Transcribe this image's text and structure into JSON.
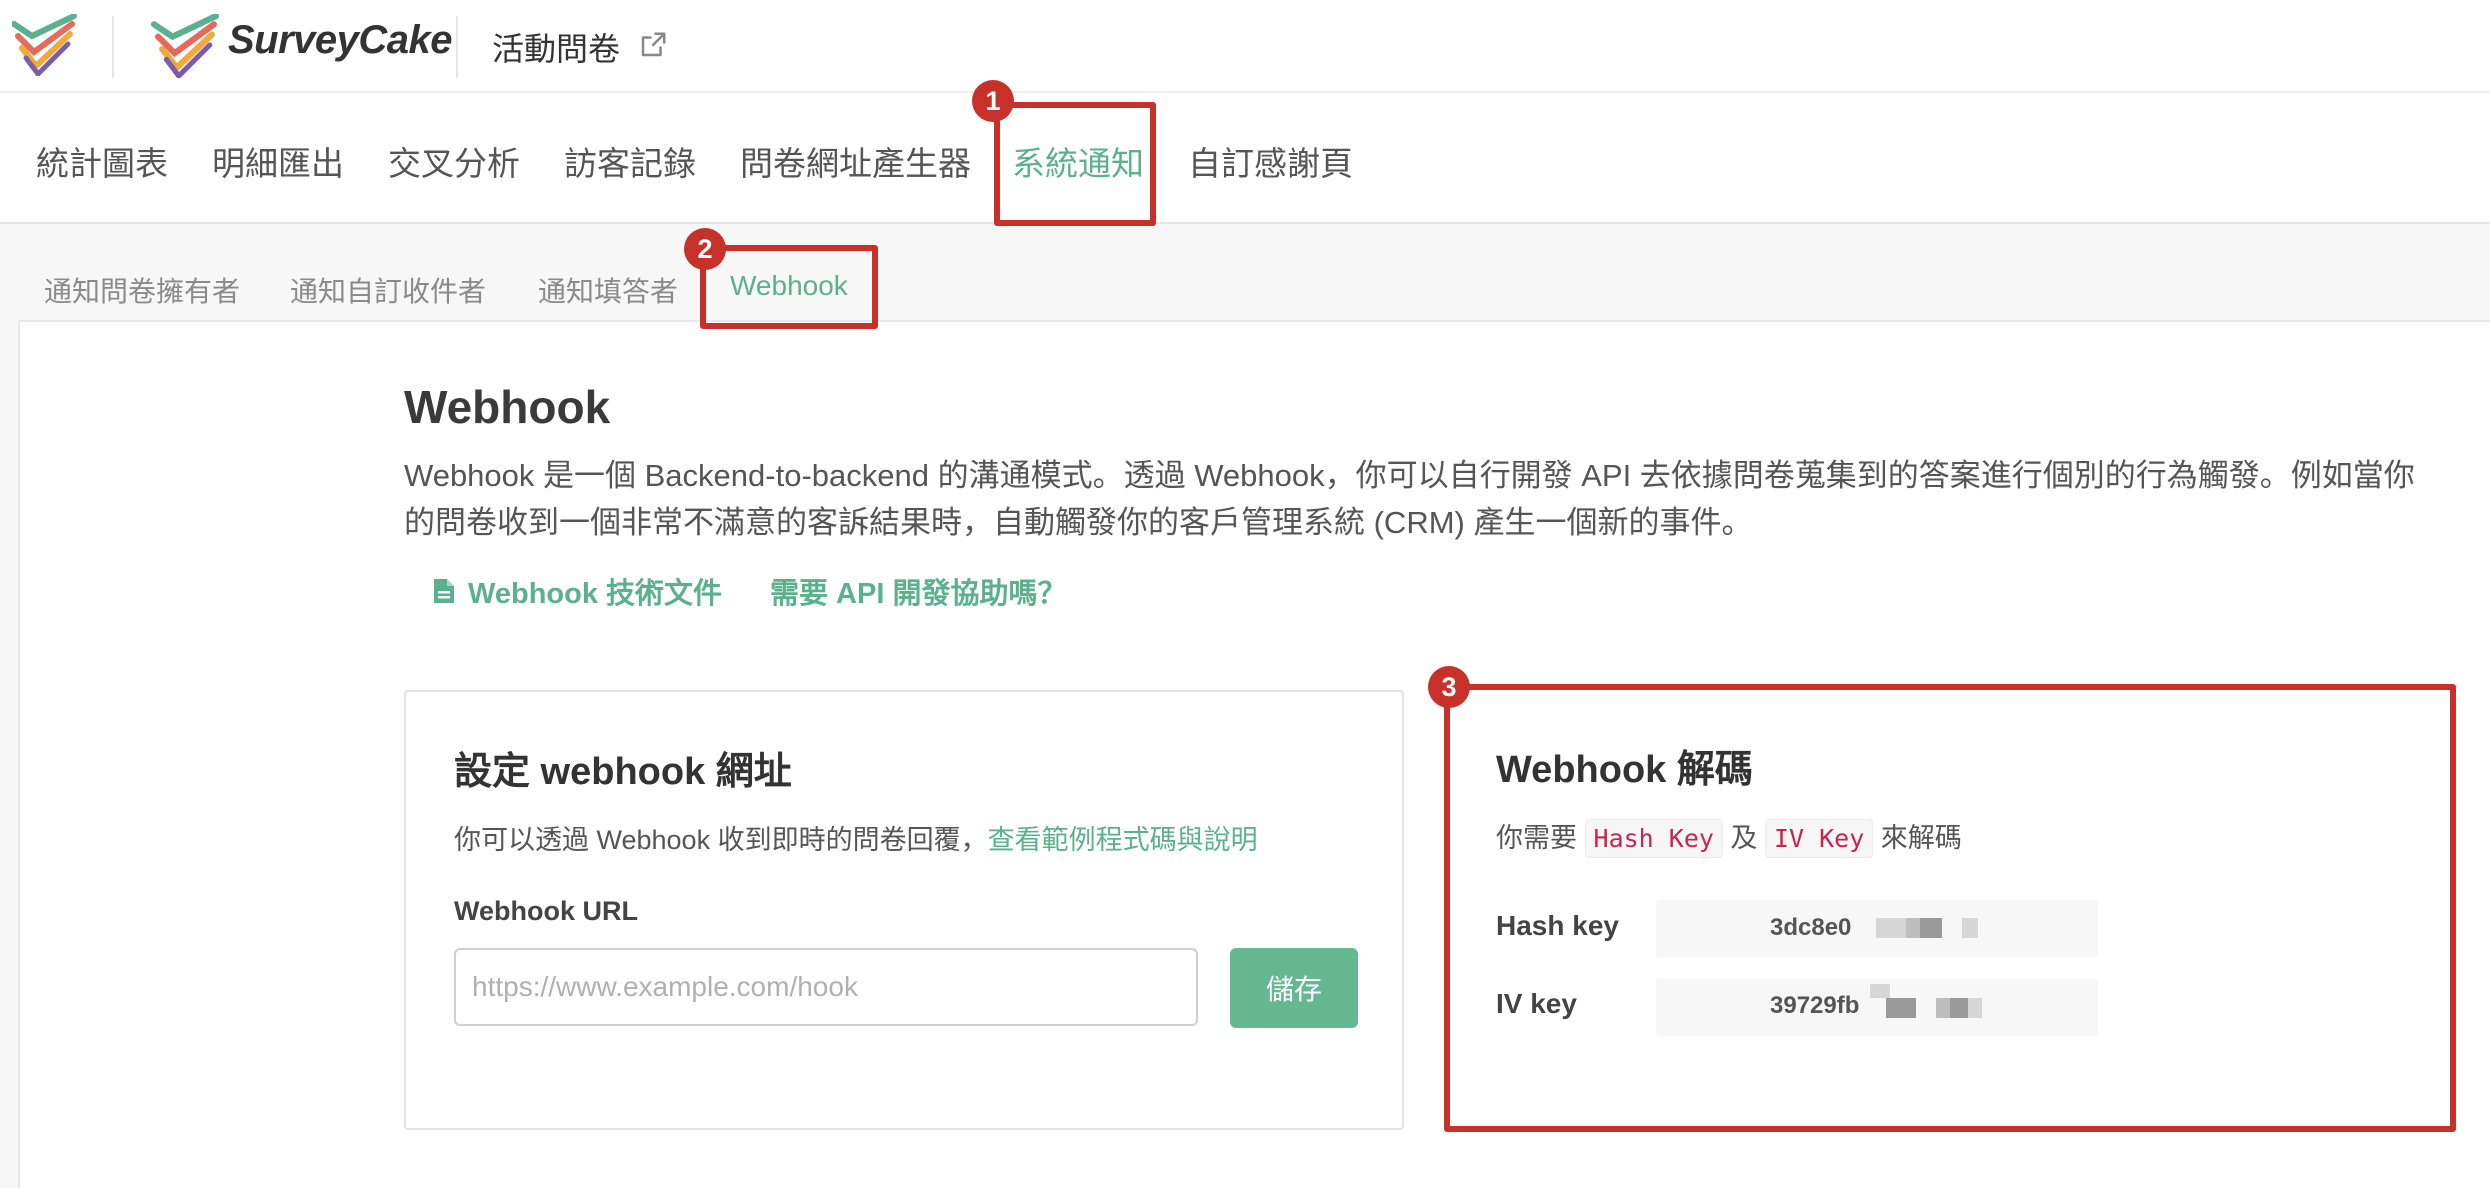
{
  "header": {
    "brand": "SurveyCake",
    "survey_title": "活動問卷"
  },
  "main_tabs": [
    {
      "label": "統計圖表"
    },
    {
      "label": "明細匯出"
    },
    {
      "label": "交叉分析"
    },
    {
      "label": "訪客記錄"
    },
    {
      "label": "問卷網址產生器"
    },
    {
      "label": "系統通知",
      "active": true
    },
    {
      "label": "自訂感謝頁"
    }
  ],
  "sub_tabs": [
    {
      "label": "通知問卷擁有者"
    },
    {
      "label": "通知自訂收件者"
    },
    {
      "label": "通知填答者"
    },
    {
      "label": "Webhook",
      "active": true
    }
  ],
  "content": {
    "title": "Webhook",
    "description": "Webhook 是一個 Backend-to-backend 的溝通模式。透過 Webhook，你可以自行開發 API 去依據問卷蒐集到的答案進行個別的行為觸發。例如當你的問卷收到一個非常不滿意的客訴結果時，自動觸發你的客戶管理系統 (CRM) 產生一個新的事件。",
    "doc_link": "Webhook 技術文件",
    "help_link": "需要 API 開發協助嗎？"
  },
  "setup_card": {
    "title": "設定 webhook 網址",
    "subtitle": "你可以透過 Webhook 收到即時的問卷回覆，",
    "subtitle_link": "查看範例程式碼與說明",
    "field_label": "Webhook URL",
    "placeholder": "https://www.example.com/hook",
    "value": "",
    "save_label": "儲存"
  },
  "decode_card": {
    "title": "Webhook 解碼",
    "text_prefix": "你需要",
    "code1": "Hash Key",
    "text_mid": "及",
    "code2": "IV Key",
    "text_suffix": "來解碼",
    "hash_label": "Hash key",
    "hash_value": "3dc8e0",
    "iv_label": "IV key",
    "iv_value": "39729fb"
  },
  "annotations": [
    "1",
    "2",
    "3"
  ],
  "colors": {
    "accent": "#5bb08e",
    "annotation": "#c8312a",
    "code": "#c7254e"
  }
}
